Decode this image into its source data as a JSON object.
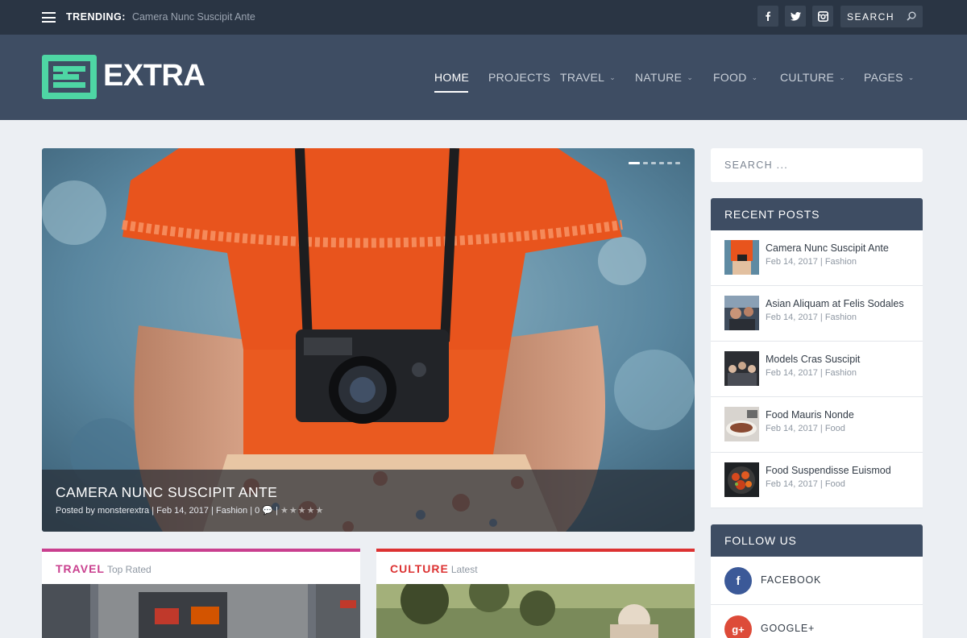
{
  "topbar": {
    "trending_label": "TRENDING:",
    "trending_value": "Camera Nunc Suscipit Ante",
    "search_placeholder": "SEARCH",
    "social": [
      "facebook-icon",
      "twitter-icon",
      "instagram-icon"
    ]
  },
  "header": {
    "logo_text": "EXTRA",
    "nav": [
      {
        "label": "HOME",
        "active": true
      },
      {
        "label": "PROJECTS"
      },
      {
        "label": "TRAVEL",
        "dropdown": true
      },
      {
        "label": "NATURE",
        "dropdown": true
      },
      {
        "label": "FOOD",
        "dropdown": true
      },
      {
        "label": "CULTURE",
        "dropdown": true
      },
      {
        "label": "PAGES",
        "dropdown": true
      }
    ]
  },
  "hero": {
    "title": "CAMERA NUNC SUSCIPIT ANTE",
    "meta_prefix": "Posted by",
    "author": "monsterextra",
    "date": "Feb 14, 2017",
    "category": "Fashion",
    "comments": "0",
    "rating_stars": "★★★★★",
    "slides_total": 6,
    "slide_active": 1
  },
  "sidebar": {
    "search_placeholder": "SEARCH ...",
    "recent_title": "RECENT POSTS",
    "recent_posts": [
      {
        "title": "Camera Nunc Suscipit Ante",
        "date": "Feb 14, 2017",
        "category": "Fashion"
      },
      {
        "title": "Asian Aliquam at Felis Sodales",
        "date": "Feb 14, 2017",
        "category": "Fashion"
      },
      {
        "title": "Models Cras Suscipit",
        "date": "Feb 14, 2017",
        "category": "Fashion"
      },
      {
        "title": "Food Mauris Nonde",
        "date": "Feb 14, 2017",
        "category": "Food"
      },
      {
        "title": "Food Suspendisse Euismod",
        "date": "Feb 14, 2017",
        "category": "Food"
      }
    ],
    "follow_title": "FOLLOW US",
    "follow": [
      {
        "label": "FACEBOOK",
        "glyph": "f",
        "color": "#3b5998"
      },
      {
        "label": "GOOGLE+",
        "glyph": "g+",
        "color": "#dd4b39"
      }
    ]
  },
  "cards": [
    {
      "category": "TRAVEL",
      "sub": "Top Rated",
      "color": "#c93f8e"
    },
    {
      "category": "CULTURE",
      "sub": "Latest",
      "color": "#dc3232"
    }
  ],
  "colors": {
    "topbar": "#2a3544",
    "header": "#3e4d63",
    "accent": "#4ed6a4",
    "page_bg": "#eceff3"
  }
}
